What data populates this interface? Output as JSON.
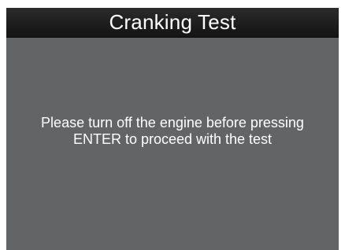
{
  "header": {
    "title": "Cranking Test"
  },
  "message": {
    "line1": "Please turn off the engine before pressing",
    "line2": "ENTER to proceed with the test"
  },
  "colors": {
    "screen_background": "#636466",
    "title_bar": "#1e1e1e",
    "text": "#ffffff"
  }
}
